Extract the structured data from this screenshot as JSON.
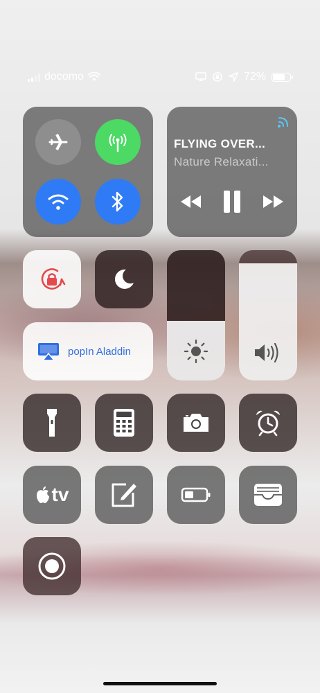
{
  "status_bar": {
    "carrier": "docomo",
    "battery_percent": "72%",
    "battery_level": 0.72
  },
  "connectivity": {
    "airplane_mode": "off",
    "cellular_data": "on",
    "wifi": "on",
    "bluetooth": "on"
  },
  "media": {
    "title": "FLYING OVER...",
    "subtitle": "Nature Relaxati..."
  },
  "airplay": {
    "label": "popIn Aladdin"
  },
  "sliders": {
    "brightness_level": 0.46,
    "volume_level": 0.9
  },
  "controls": [
    "orientation-lock-icon",
    "do-not-disturb-icon",
    "flashlight-icon",
    "calculator-icon",
    "camera-icon",
    "alarm-icon",
    "apple-tv-remote-icon",
    "notes-icon",
    "low-power-mode-icon",
    "wallet-icon",
    "screen-recording-icon"
  ],
  "apple_tv_label": "tv",
  "colors": {
    "active_green": "#4cd964",
    "active_blue": "#2f7bf5",
    "airplay_blue": "#2f6ee0",
    "orientation_red": "#e5484d"
  }
}
